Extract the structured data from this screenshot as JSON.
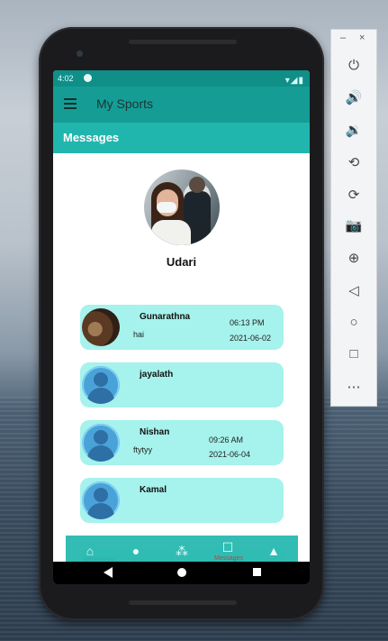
{
  "status_bar": {
    "time": "4:02",
    "signal": "▾◢▮"
  },
  "app_bar": {
    "title": "My Sports",
    "menu_icon": "hamburger-menu-icon"
  },
  "section": {
    "title": "Messages"
  },
  "profile": {
    "name": "Udari"
  },
  "conversations": [
    {
      "name": "Gunarathna",
      "message": "hai",
      "time": "06:13 PM",
      "date": "2021-06-02",
      "avatar": "photo"
    },
    {
      "name": "jayalath",
      "message": "",
      "time": "",
      "date": "",
      "avatar": "default-person-icon"
    },
    {
      "name": "Nishan",
      "message": "ftytyy",
      "time": "09:26 AM",
      "date": "2021-06-04",
      "avatar": "default-person-icon"
    },
    {
      "name": "Kamal",
      "message": "",
      "time": "",
      "date": "",
      "avatar": "default-person-icon"
    }
  ],
  "partial_conversation": {
    "message": "hai",
    "date": "2021-06-02"
  },
  "bottom_nav": {
    "items": [
      {
        "icon": "home-icon"
      },
      {
        "icon": "person-icon"
      },
      {
        "icon": "group-icon"
      },
      {
        "icon": "chat-icon",
        "label": "Messages"
      },
      {
        "icon": "bell-icon"
      }
    ]
  },
  "system_nav": {
    "back": "back-icon",
    "home": "home-icon",
    "recents": "recents-icon"
  },
  "emulator_panel": {
    "minimize": "–",
    "close": "×",
    "buttons": [
      "power-icon",
      "volume-up-icon",
      "volume-down-icon",
      "rotate-left-icon",
      "rotate-right-icon",
      "camera-icon",
      "zoom-icon",
      "back-icon",
      "home-icon",
      "overview-icon",
      "more-icon"
    ],
    "glyphs": [
      "⏻",
      "🔊",
      "🔉",
      "⟲",
      "⟳",
      "📷",
      "⊕",
      "◁",
      "○",
      "□",
      "⋯"
    ]
  }
}
